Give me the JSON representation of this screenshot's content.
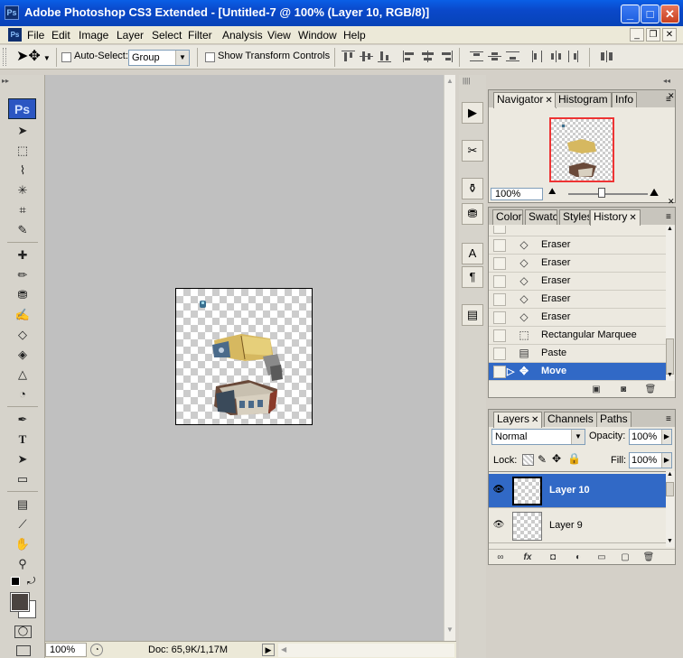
{
  "window": {
    "title": "Adobe Photoshop CS3 Extended - [Untitled-7 @ 100% (Layer 10, RGB/8)]",
    "ps_label": "Ps",
    "min": "_",
    "max": "□",
    "close": "✕"
  },
  "menubar": {
    "items": [
      "File",
      "Edit",
      "Image",
      "Layer",
      "Select",
      "Filter",
      "Analysis",
      "View",
      "Window",
      "Help"
    ],
    "min": "_",
    "restore": "❐",
    "close": "✕"
  },
  "options": {
    "auto_select_label": "Auto-Select:",
    "auto_select_value": "Group",
    "show_transform_label": "Show Transform Controls"
  },
  "toolbox": {
    "logo": "Ps"
  },
  "status": {
    "zoom": "100%",
    "doc": "Doc: 65,9K/1,17M"
  },
  "navigator": {
    "tabs": [
      "Navigator",
      "Histogram",
      "Info"
    ],
    "zoom": "100%"
  },
  "history": {
    "tabs": [
      "Color",
      "Swatc",
      "Styles",
      "History"
    ],
    "items": [
      {
        "icon": "eraser-icon",
        "glyph": "◇",
        "label": "Eraser",
        "selected": false
      },
      {
        "icon": "eraser-icon",
        "glyph": "◇",
        "label": "Eraser",
        "selected": false
      },
      {
        "icon": "eraser-icon",
        "glyph": "◇",
        "label": "Eraser",
        "selected": false
      },
      {
        "icon": "eraser-icon",
        "glyph": "◇",
        "label": "Eraser",
        "selected": false
      },
      {
        "icon": "eraser-icon",
        "glyph": "◇",
        "label": "Eraser",
        "selected": false
      },
      {
        "icon": "marquee-icon",
        "glyph": "⬚",
        "label": "Rectangular Marquee",
        "selected": false
      },
      {
        "icon": "paste-icon",
        "glyph": "▤",
        "label": "Paste",
        "selected": false
      },
      {
        "icon": "move-icon",
        "glyph": "✥",
        "label": "Move",
        "selected": true
      }
    ]
  },
  "layers": {
    "tabs": [
      "Layers",
      "Channels",
      "Paths"
    ],
    "blend_mode": "Normal",
    "opacity_label": "Opacity:",
    "opacity": "100%",
    "lock_label": "Lock:",
    "fill_label": "Fill:",
    "fill": "100%",
    "items": [
      {
        "name": "Layer 10",
        "selected": true
      },
      {
        "name": "Layer 9",
        "selected": false
      }
    ]
  }
}
